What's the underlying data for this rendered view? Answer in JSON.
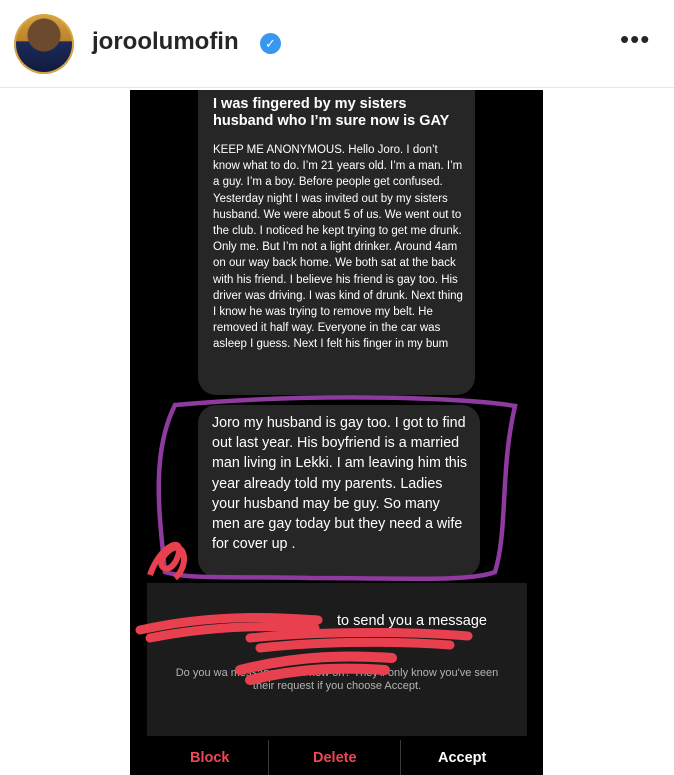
{
  "header": {
    "username": "joroolumofin",
    "more_icon": "•••"
  },
  "message1": {
    "title": "I was fingered by my sisters husband who I’m sure now is GAY",
    "body": "KEEP ME ANONYMOUS. Hello Joro. I don’t know what to do. I’m 21 years old. I’m a man. I’m a guy. I’m a boy. Before people get confused. Yesterday night I was invited out by my sisters husband. We were about 5 of us. We went out to the club. I noticed he kept trying to get me drunk. Only me. But I’m not a light drinker. Around 4am on our way back home. We both sat at the back with his friend. I believe his friend is gay too. His driver was driving.  I was kind of drunk. Next thing I know he was trying to remove my belt. He removed it half way. Everyone in the car was asleep I guess. Next I felt his finger in my bum"
  },
  "message2": {
    "text": "Joro my husband is gay too. I got to find out last year. His boyfriend is a married man living in Lekki. I am leaving him this year already told my parents. Ladies your husband may be guy. So many men are gay today but they need a wife for cover up ."
  },
  "request": {
    "title_visible": "to send you a message",
    "body_visible": "Do you wa                                         messages from now on? They'll only know you've seen their request if you choose Accept."
  },
  "actions": {
    "block": "Block",
    "delete": "Delete",
    "accept": "Accept"
  },
  "colors": {
    "verified": "#3897f0",
    "highlight_outline": "#8e3a9e",
    "redaction": "#e8404e",
    "danger": "#ed4956"
  }
}
